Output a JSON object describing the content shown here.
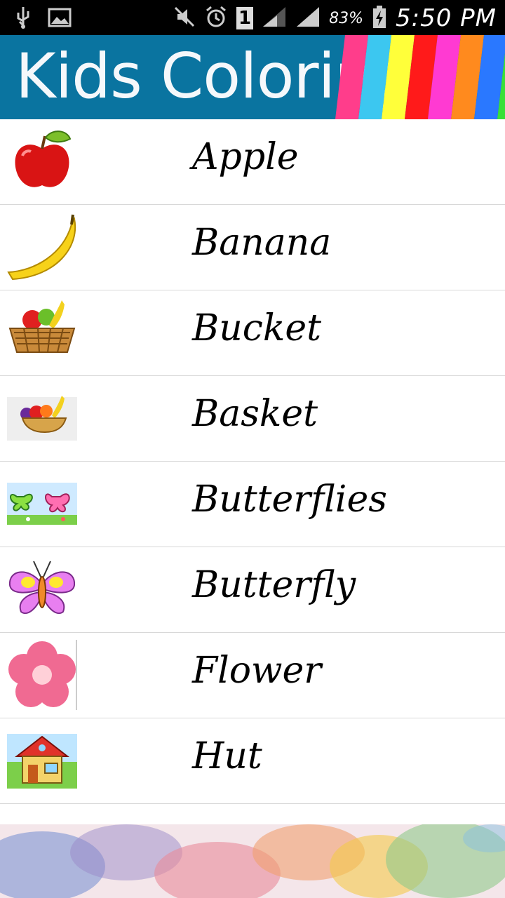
{
  "status_bar": {
    "icons": [
      "usb-icon",
      "image-icon",
      "mute-icon",
      "alarm-icon",
      "sim-icon",
      "signal-icon",
      "signal-icon",
      "battery-charging-icon"
    ],
    "sim_label": "1",
    "battery_pct": "83%",
    "time": "5:50 PM"
  },
  "header": {
    "title": "Kids Coloring",
    "stripe_colors": [
      "#ff3d8b",
      "#3cc7f0",
      "#ffff3a",
      "#ff1a1a",
      "#ff3ad2",
      "#ff8a1e",
      "#2a78ff",
      "#38e038"
    ]
  },
  "items": [
    {
      "label": "Apple",
      "icon": "apple-icon"
    },
    {
      "label": "Banana",
      "icon": "banana-icon"
    },
    {
      "label": "Bucket",
      "icon": "fruit-bucket-icon"
    },
    {
      "label": "Basket",
      "icon": "fruit-basket-icon"
    },
    {
      "label": "Butterflies",
      "icon": "butterflies-icon"
    },
    {
      "label": "Butterfly",
      "icon": "butterfly-icon"
    },
    {
      "label": "Flower",
      "icon": "flower-icon"
    },
    {
      "label": "Hut",
      "icon": "hut-icon"
    }
  ]
}
